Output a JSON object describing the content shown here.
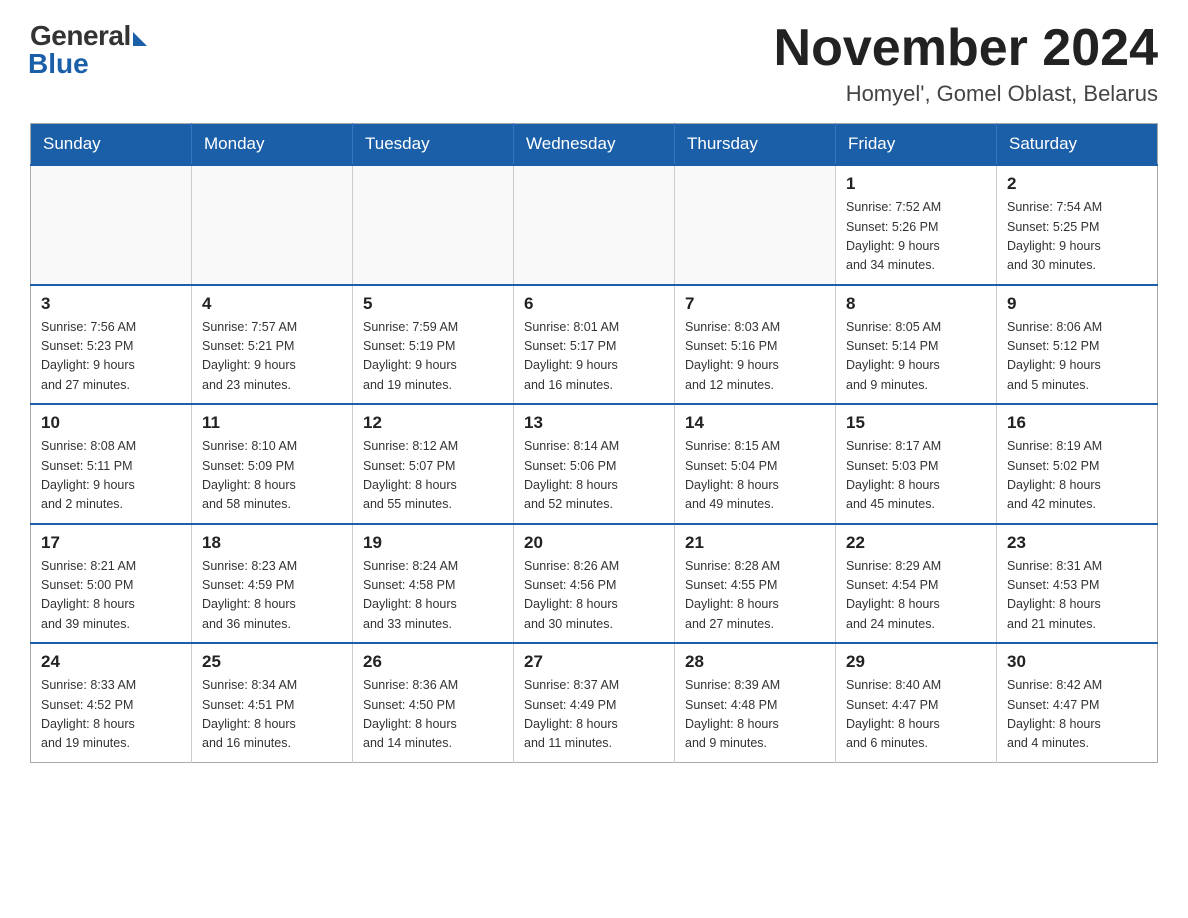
{
  "header": {
    "logo_general": "General",
    "logo_blue": "Blue",
    "title": "November 2024",
    "subtitle": "Homyel', Gomel Oblast, Belarus"
  },
  "days_of_week": [
    "Sunday",
    "Monday",
    "Tuesday",
    "Wednesday",
    "Thursday",
    "Friday",
    "Saturday"
  ],
  "weeks": [
    [
      {
        "day": "",
        "info": ""
      },
      {
        "day": "",
        "info": ""
      },
      {
        "day": "",
        "info": ""
      },
      {
        "day": "",
        "info": ""
      },
      {
        "day": "",
        "info": ""
      },
      {
        "day": "1",
        "info": "Sunrise: 7:52 AM\nSunset: 5:26 PM\nDaylight: 9 hours\nand 34 minutes."
      },
      {
        "day": "2",
        "info": "Sunrise: 7:54 AM\nSunset: 5:25 PM\nDaylight: 9 hours\nand 30 minutes."
      }
    ],
    [
      {
        "day": "3",
        "info": "Sunrise: 7:56 AM\nSunset: 5:23 PM\nDaylight: 9 hours\nand 27 minutes."
      },
      {
        "day": "4",
        "info": "Sunrise: 7:57 AM\nSunset: 5:21 PM\nDaylight: 9 hours\nand 23 minutes."
      },
      {
        "day": "5",
        "info": "Sunrise: 7:59 AM\nSunset: 5:19 PM\nDaylight: 9 hours\nand 19 minutes."
      },
      {
        "day": "6",
        "info": "Sunrise: 8:01 AM\nSunset: 5:17 PM\nDaylight: 9 hours\nand 16 minutes."
      },
      {
        "day": "7",
        "info": "Sunrise: 8:03 AM\nSunset: 5:16 PM\nDaylight: 9 hours\nand 12 minutes."
      },
      {
        "day": "8",
        "info": "Sunrise: 8:05 AM\nSunset: 5:14 PM\nDaylight: 9 hours\nand 9 minutes."
      },
      {
        "day": "9",
        "info": "Sunrise: 8:06 AM\nSunset: 5:12 PM\nDaylight: 9 hours\nand 5 minutes."
      }
    ],
    [
      {
        "day": "10",
        "info": "Sunrise: 8:08 AM\nSunset: 5:11 PM\nDaylight: 9 hours\nand 2 minutes."
      },
      {
        "day": "11",
        "info": "Sunrise: 8:10 AM\nSunset: 5:09 PM\nDaylight: 8 hours\nand 58 minutes."
      },
      {
        "day": "12",
        "info": "Sunrise: 8:12 AM\nSunset: 5:07 PM\nDaylight: 8 hours\nand 55 minutes."
      },
      {
        "day": "13",
        "info": "Sunrise: 8:14 AM\nSunset: 5:06 PM\nDaylight: 8 hours\nand 52 minutes."
      },
      {
        "day": "14",
        "info": "Sunrise: 8:15 AM\nSunset: 5:04 PM\nDaylight: 8 hours\nand 49 minutes."
      },
      {
        "day": "15",
        "info": "Sunrise: 8:17 AM\nSunset: 5:03 PM\nDaylight: 8 hours\nand 45 minutes."
      },
      {
        "day": "16",
        "info": "Sunrise: 8:19 AM\nSunset: 5:02 PM\nDaylight: 8 hours\nand 42 minutes."
      }
    ],
    [
      {
        "day": "17",
        "info": "Sunrise: 8:21 AM\nSunset: 5:00 PM\nDaylight: 8 hours\nand 39 minutes."
      },
      {
        "day": "18",
        "info": "Sunrise: 8:23 AM\nSunset: 4:59 PM\nDaylight: 8 hours\nand 36 minutes."
      },
      {
        "day": "19",
        "info": "Sunrise: 8:24 AM\nSunset: 4:58 PM\nDaylight: 8 hours\nand 33 minutes."
      },
      {
        "day": "20",
        "info": "Sunrise: 8:26 AM\nSunset: 4:56 PM\nDaylight: 8 hours\nand 30 minutes."
      },
      {
        "day": "21",
        "info": "Sunrise: 8:28 AM\nSunset: 4:55 PM\nDaylight: 8 hours\nand 27 minutes."
      },
      {
        "day": "22",
        "info": "Sunrise: 8:29 AM\nSunset: 4:54 PM\nDaylight: 8 hours\nand 24 minutes."
      },
      {
        "day": "23",
        "info": "Sunrise: 8:31 AM\nSunset: 4:53 PM\nDaylight: 8 hours\nand 21 minutes."
      }
    ],
    [
      {
        "day": "24",
        "info": "Sunrise: 8:33 AM\nSunset: 4:52 PM\nDaylight: 8 hours\nand 19 minutes."
      },
      {
        "day": "25",
        "info": "Sunrise: 8:34 AM\nSunset: 4:51 PM\nDaylight: 8 hours\nand 16 minutes."
      },
      {
        "day": "26",
        "info": "Sunrise: 8:36 AM\nSunset: 4:50 PM\nDaylight: 8 hours\nand 14 minutes."
      },
      {
        "day": "27",
        "info": "Sunrise: 8:37 AM\nSunset: 4:49 PM\nDaylight: 8 hours\nand 11 minutes."
      },
      {
        "day": "28",
        "info": "Sunrise: 8:39 AM\nSunset: 4:48 PM\nDaylight: 8 hours\nand 9 minutes."
      },
      {
        "day": "29",
        "info": "Sunrise: 8:40 AM\nSunset: 4:47 PM\nDaylight: 8 hours\nand 6 minutes."
      },
      {
        "day": "30",
        "info": "Sunrise: 8:42 AM\nSunset: 4:47 PM\nDaylight: 8 hours\nand 4 minutes."
      }
    ]
  ]
}
